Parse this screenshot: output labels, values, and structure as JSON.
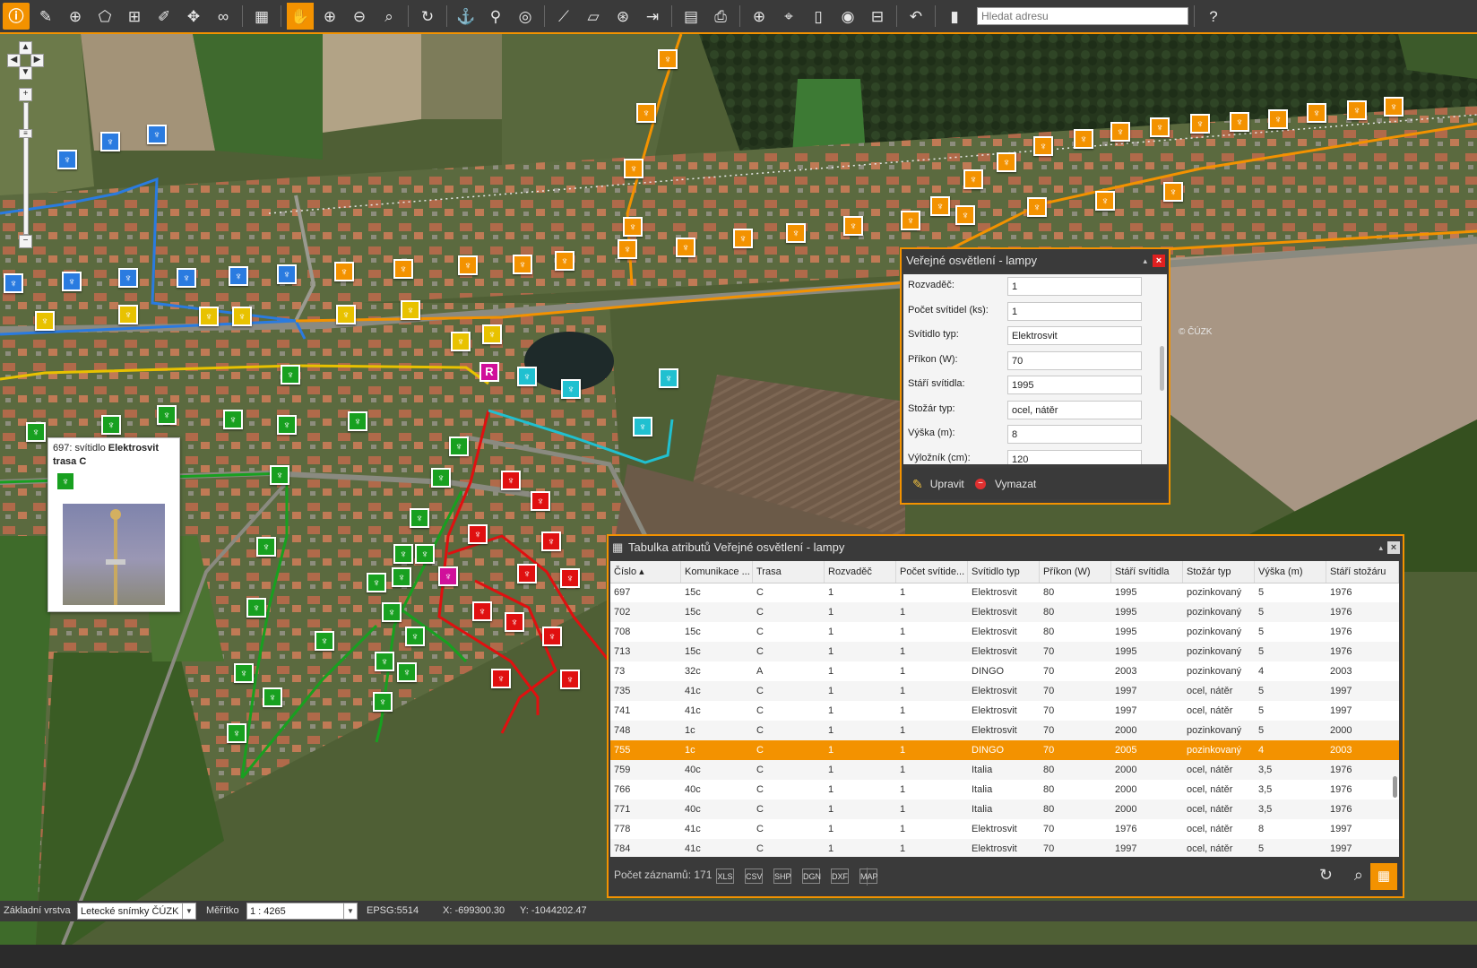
{
  "toolbar": {
    "search_placeholder": "Hledat adresu",
    "tools": [
      "info",
      "draw-line",
      "draw-point",
      "draw-polygon",
      "add-object",
      "edit-geometry",
      "move",
      "binoculars",
      "calculator",
      "pan",
      "zoom-in",
      "zoom-out",
      "zoom-search",
      "refresh",
      "pin-a",
      "pin-b",
      "locate",
      "measure-distance",
      "measure-area",
      "globe",
      "export",
      "document",
      "print",
      "globe-grid",
      "find-object",
      "clipboard",
      "speed",
      "layers",
      "history",
      "bookmark",
      "help"
    ]
  },
  "popup": {
    "title_prefix": "697: svítidlo ",
    "title_bold": "Elektrosvit trasa C"
  },
  "form": {
    "title": "Veřejné osvětlení - lampy",
    "fields": [
      {
        "label": "Rozvaděč:",
        "value": "1"
      },
      {
        "label": "Počet svítidel (ks):",
        "value": "1"
      },
      {
        "label": "Svítidlo typ:",
        "value": "Elektrosvit"
      },
      {
        "label": "Příkon (W):",
        "value": "70"
      },
      {
        "label": "Stáří svítidla:",
        "value": "1995"
      },
      {
        "label": "Stožár typ:",
        "value": "ocel, nátěr"
      },
      {
        "label": "Výška (m):",
        "value": "8"
      },
      {
        "label": "Výložník (cm):",
        "value": "120"
      }
    ],
    "edit_label": "Upravit",
    "delete_label": "Vymazat"
  },
  "map": {
    "watermark": "© ČÚZK"
  },
  "table": {
    "title": "Tabulka atributů Veřejné osvětlení - lampy",
    "columns": [
      "Číslo ▴",
      "Komunikace ...",
      "Trasa",
      "Rozvaděč",
      "Počet svítide...",
      "Svítidlo typ",
      "Příkon (W)",
      "Stáří svítidla",
      "Stožár typ",
      "Výška (m)",
      "Stáří stožáru"
    ],
    "rows": [
      [
        "697",
        "15c",
        "C",
        "1",
        "1",
        "Elektrosvit",
        "80",
        "1995",
        "pozinkovaný",
        "5",
        "1976"
      ],
      [
        "702",
        "15c",
        "C",
        "1",
        "1",
        "Elektrosvit",
        "80",
        "1995",
        "pozinkovaný",
        "5",
        "1976"
      ],
      [
        "708",
        "15c",
        "C",
        "1",
        "1",
        "Elektrosvit",
        "80",
        "1995",
        "pozinkovaný",
        "5",
        "1976"
      ],
      [
        "713",
        "15c",
        "C",
        "1",
        "1",
        "Elektrosvit",
        "70",
        "1995",
        "pozinkovaný",
        "5",
        "1976"
      ],
      [
        "73",
        "32c",
        "A",
        "1",
        "1",
        "DINGO",
        "70",
        "2003",
        "pozinkovaný",
        "4",
        "2003"
      ],
      [
        "735",
        "41c",
        "C",
        "1",
        "1",
        "Elektrosvit",
        "70",
        "1997",
        "ocel, nátěr",
        "5",
        "1997"
      ],
      [
        "741",
        "41c",
        "C",
        "1",
        "1",
        "Elektrosvit",
        "70",
        "1997",
        "ocel, nátěr",
        "5",
        "1997"
      ],
      [
        "748",
        "1c",
        "C",
        "1",
        "1",
        "Elektrosvit",
        "70",
        "2000",
        "pozinkovaný",
        "5",
        "2000"
      ],
      [
        "755",
        "1c",
        "C",
        "1",
        "1",
        "DINGO",
        "70",
        "2005",
        "pozinkovaný",
        "4",
        "2003"
      ],
      [
        "759",
        "40c",
        "C",
        "1",
        "1",
        "Italia",
        "80",
        "2000",
        "ocel, nátěr",
        "3,5",
        "1976"
      ],
      [
        "766",
        "40c",
        "C",
        "1",
        "1",
        "Italia",
        "80",
        "2000",
        "ocel, nátěr",
        "3,5",
        "1976"
      ],
      [
        "771",
        "40c",
        "C",
        "1",
        "1",
        "Italia",
        "80",
        "2000",
        "ocel, nátěr",
        "3,5",
        "1976"
      ],
      [
        "778",
        "41c",
        "C",
        "1",
        "1",
        "Elektrosvit",
        "70",
        "1976",
        "ocel, nátěr",
        "8",
        "1997"
      ],
      [
        "784",
        "41c",
        "C",
        "1",
        "1",
        "Elektrosvit",
        "70",
        "1997",
        "ocel, nátěr",
        "5",
        "1997"
      ]
    ],
    "selected_row": "755",
    "record_count_label": "Počet záznamů: 171",
    "export_buttons": [
      "XLS",
      "CSV",
      "SHP",
      "DGN",
      "DXF",
      "MAP"
    ]
  },
  "status": {
    "base_layer_label": "Základní vrstva",
    "base_layer_value": "Letecké snímky ČÚZK",
    "scale_label": "Měřítko",
    "scale_value": "1 : 4265",
    "epsg": "EPSG:5514",
    "x_coord": "X: -699300.30",
    "y_coord": "Y: -1044202.47"
  },
  "colors": {
    "accent": "#f39200",
    "route_orange": "#f39200",
    "route_blue": "#2a7be0",
    "route_yellow": "#e8c200",
    "route_green": "#18a020",
    "route_red": "#e01010",
    "route_cyan": "#20c0d0",
    "route_magenta": "#d0109a"
  }
}
